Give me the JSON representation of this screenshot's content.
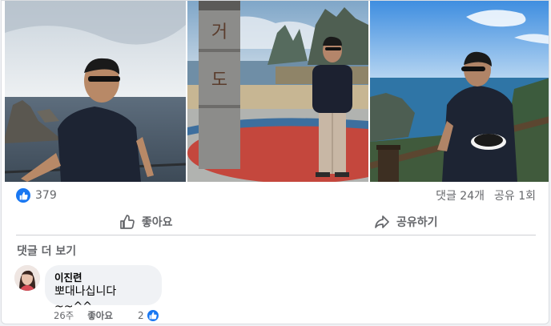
{
  "post": {
    "photos": [
      {
        "name": "photo-coastal-rocks"
      },
      {
        "name": "photo-monument-plaza"
      },
      {
        "name": "photo-cliff-railing"
      }
    ],
    "reactions": {
      "count": "379"
    },
    "comment_count": "댓글 24개",
    "share_count": "공유 1회",
    "actions": {
      "like_label": "좋아요",
      "share_label": "공유하기"
    },
    "more_comments": "댓글 더 보기"
  },
  "comment": {
    "author": "이진련",
    "text": "뽀대나십니다~~^^",
    "time": "26주",
    "like_label": "좋아요",
    "reaction_count": "2"
  },
  "colors": {
    "accent": "#1877f2",
    "muted": "#65676b",
    "bubble": "#f0f2f5"
  },
  "icons": [
    "thumbs-up-icon",
    "share-arrow-icon",
    "like-badge-icon"
  ]
}
